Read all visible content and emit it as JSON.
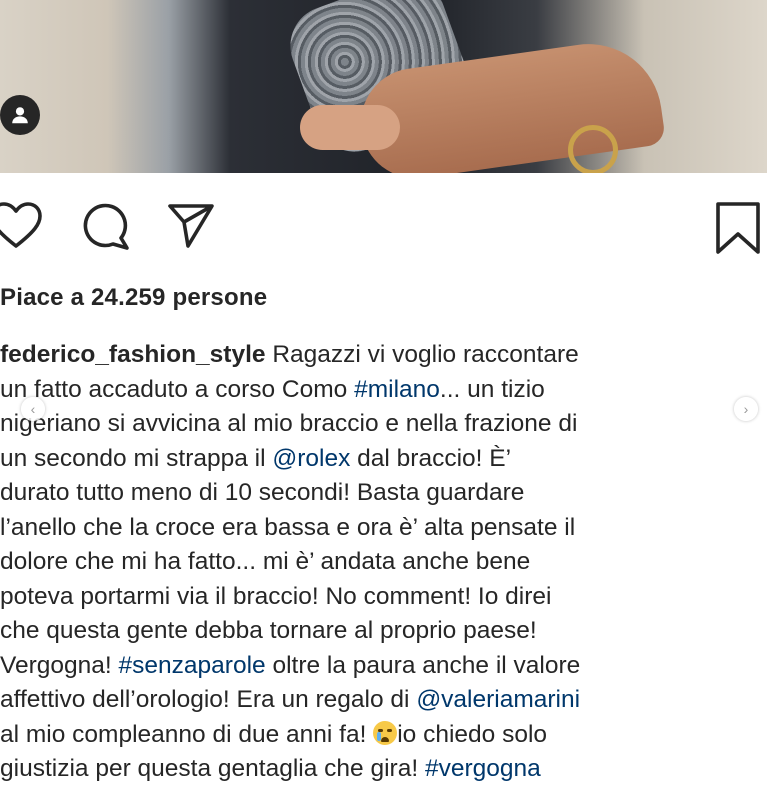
{
  "post": {
    "likes_text": "Piace a 24.259 persone",
    "caption_lines": [
      [
        {
          "t": "federico_fashion_style",
          "k": "user"
        },
        {
          "t": " Ragazzi vi voglio raccontare",
          "k": "text"
        }
      ],
      [
        {
          "t": "un fatto accaduto a corso Como ",
          "k": "text"
        },
        {
          "t": "#milano",
          "k": "tag"
        },
        {
          "t": "... un tizio",
          "k": "text"
        }
      ],
      [
        {
          "t": "nigeriano si avvicina al mio braccio e nella frazione di",
          "k": "text"
        }
      ],
      [
        {
          "t": "un secondo mi strappa il ",
          "k": "text"
        },
        {
          "t": "@rolex",
          "k": "tag"
        },
        {
          "t": " dal braccio! È’",
          "k": "text"
        }
      ],
      [
        {
          "t": "durato tutto meno di 10 secondi! Basta guardare",
          "k": "text"
        }
      ],
      [
        {
          "t": "l’anello che la croce era bassa e ora è’ alta pensate il",
          "k": "text"
        }
      ],
      [
        {
          "t": "dolore che mi ha fatto... mi è’ andata anche bene",
          "k": "text"
        }
      ],
      [
        {
          "t": "poteva portarmi via il braccio! No comment! Io direi",
          "k": "text"
        }
      ],
      [
        {
          "t": "che questa gente debba tornare al proprio paese!",
          "k": "text"
        }
      ],
      [
        {
          "t": "Vergogna! ",
          "k": "text"
        },
        {
          "t": "#senzaparole",
          "k": "tag"
        },
        {
          "t": " oltre la paura anche il valore",
          "k": "text"
        }
      ],
      [
        {
          "t": "affettivo dell’orologio! Era un regalo di ",
          "k": "text"
        },
        {
          "t": "@valeriamarini",
          "k": "tag"
        }
      ],
      [
        {
          "t": "al mio compleanno di due anni fa! ",
          "k": "text"
        },
        {
          "t": "crying-face-emoji",
          "k": "emoji"
        },
        {
          "t": "io chiedo solo",
          "k": "text"
        }
      ],
      [
        {
          "t": "giustizia per questa gentaglia che gira! ",
          "k": "text"
        },
        {
          "t": "#vergogna",
          "k": "tag"
        }
      ]
    ]
  },
  "icons": {
    "avatar": "user-avatar-icon",
    "like": "heart-icon",
    "comment": "comment-bubble-icon",
    "share": "paper-plane-icon",
    "save": "bookmark-icon",
    "prev": "chevron-left-icon",
    "next": "chevron-right-icon"
  },
  "colors": {
    "text": "#262626",
    "link": "#00376b"
  }
}
